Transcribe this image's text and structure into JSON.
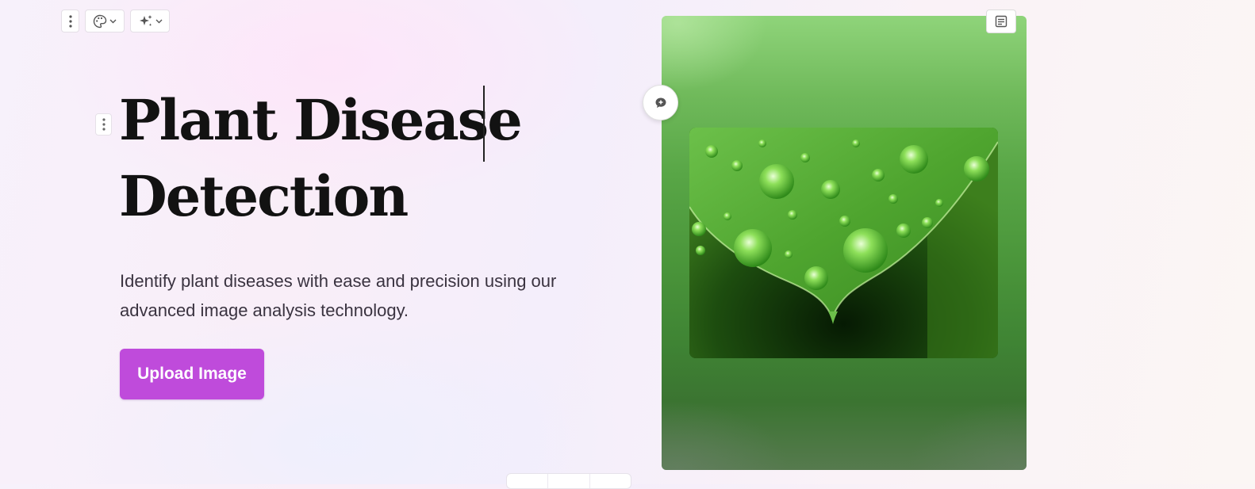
{
  "toolbar": {
    "more_icon": "vertical-dots-icon",
    "theme_icon": "palette-icon",
    "ai_icon": "sparkle-icon",
    "chevron_icon": "chevron-down-icon"
  },
  "hero": {
    "title_line1": "Plant Disease",
    "title_line2": "Detection",
    "subtitle": "Identify plant diseases with ease and precision using our advanced image analysis technology.",
    "cta_label": "Upload Image"
  },
  "image_card": {
    "photo": "leaf-with-water-droplets",
    "notes_icon": "notes-icon",
    "comment_icon": "add-comment-icon"
  },
  "colors": {
    "accent": "#bf4bdb",
    "heading": "#121212",
    "body_text": "#3a3340",
    "leaf_green": "#4a953a"
  }
}
